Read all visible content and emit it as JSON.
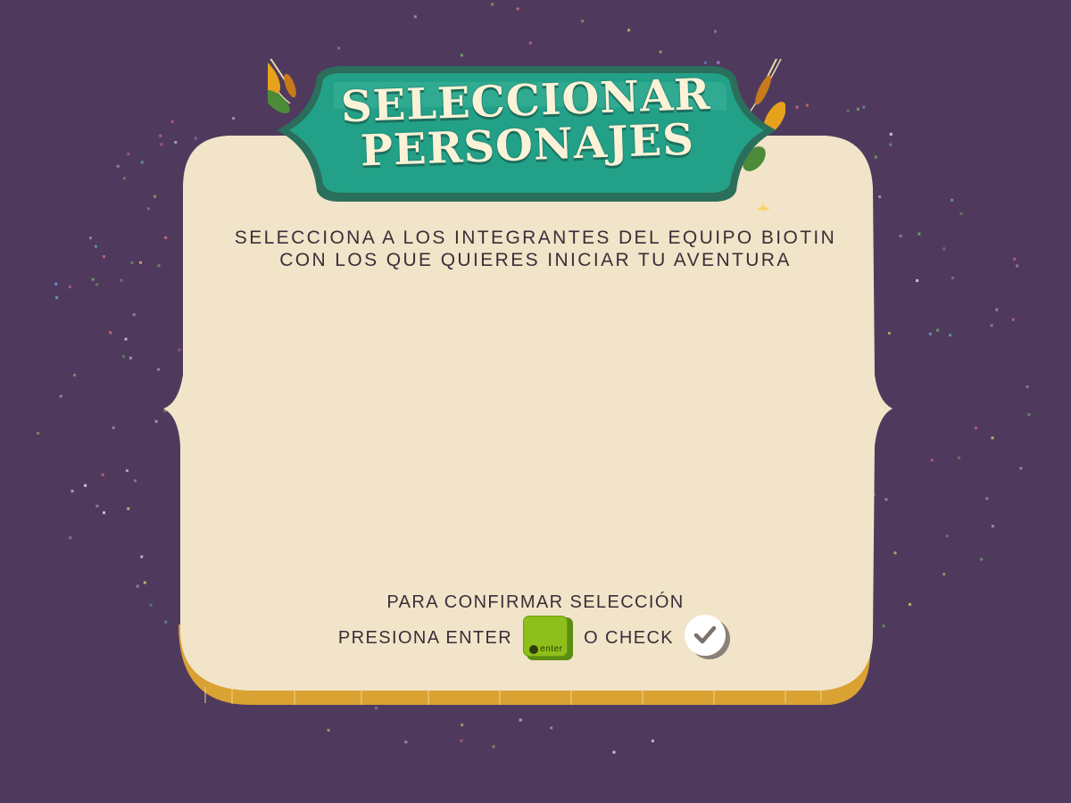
{
  "title": {
    "line1": "SELECCIONAR",
    "line2": "PERSONAJES"
  },
  "instructions": {
    "line1": "SELECCIONA A LOS INTEGRANTES DEL EQUIPO BIOTIN",
    "line2": "CON LOS QUE QUIERES INICIAR TU AVENTURA"
  },
  "confirm": {
    "line1": "PARA CONFIRMAR SELECCIÓN",
    "press_enter": "PRESIONA ENTER",
    "enter_key_label": "enter",
    "or_check": "O CHECK"
  },
  "colors": {
    "background": "#4f3a5e",
    "panel": "#f2e4c8",
    "panel_edge": "#d9a233",
    "banner": "#23a188",
    "enter_key": "#8ebf1a",
    "text": "#3b2e39"
  },
  "icons": {
    "enter_key": "enter-key-icon",
    "check": "check-icon",
    "sparkle": "sparkle-icon",
    "foliage": "foliage-decoration"
  }
}
